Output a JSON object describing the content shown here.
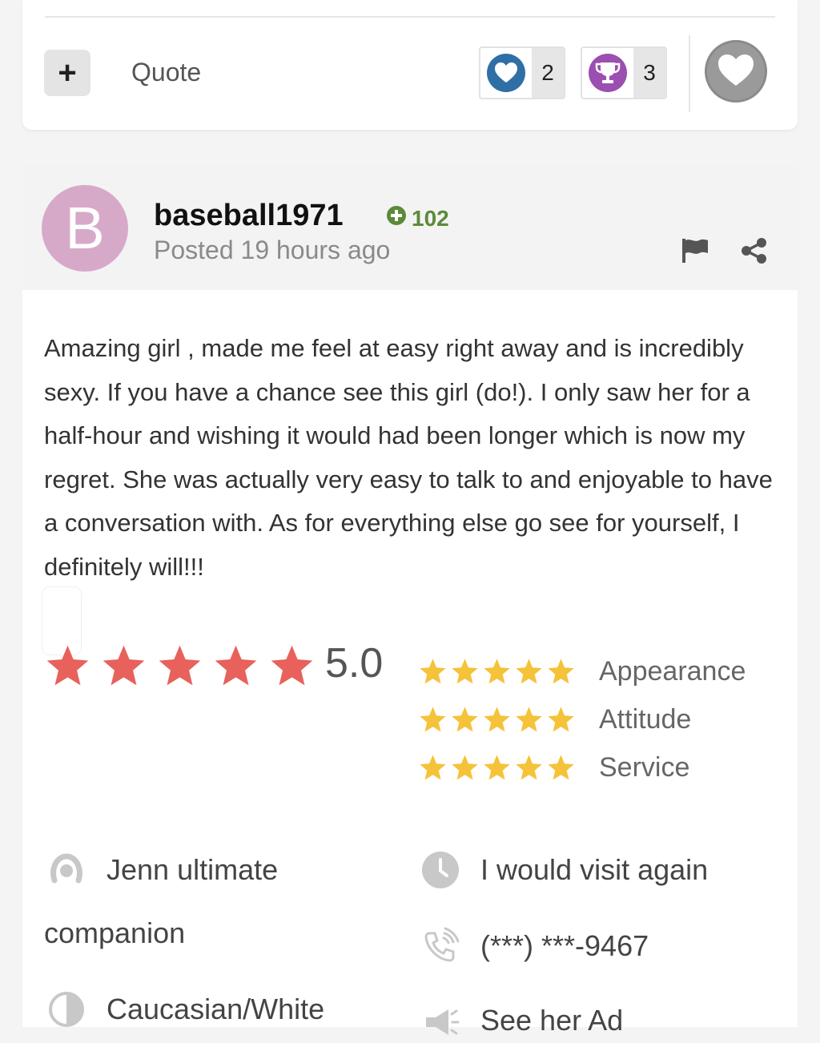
{
  "actions": {
    "add_symbol": "+",
    "quote_label": "Quote"
  },
  "reactions": {
    "like_count": "2",
    "trophy_count": "3"
  },
  "post": {
    "avatar_letter": "B",
    "username": "baseball1971",
    "points": "102",
    "posted": "Posted 19 hours ago",
    "body": "Amazing girl , made me feel at easy right away and is incredibly sexy. If you have a chance see this girl (do!). I only saw her for a half-hour and wishing it would had been longer which is now my regret. She was actually very easy to talk to and enjoyable to have a conversation with. As for everything else go see for yourself,  I definitely will!!!"
  },
  "rating": {
    "overall": "5.0",
    "overall_stars": 5,
    "categories": [
      {
        "label": "Appearance",
        "stars": 5
      },
      {
        "label": "Attitude",
        "stars": 5
      },
      {
        "label": "Service",
        "stars": 5
      }
    ]
  },
  "details": {
    "provider_line1": "Jenn ultimate",
    "provider_line2": "companion",
    "visit_again": "I would visit again",
    "phone": "(***) ***-9467",
    "ethnicity": "Caucasian/White",
    "ad_link": "See her Ad"
  },
  "colors": {
    "like_blue": "#2f6fa6",
    "trophy_purple": "#9b4fb0",
    "avatar_pink": "#d7a9c9",
    "points_green": "#5b8a3a",
    "big_star_red": "#e8615b",
    "small_star_gold": "#f5c23a"
  },
  "icons": [
    "plus-icon",
    "heart-icon",
    "trophy-icon",
    "favorite-heart-icon",
    "flag-icon",
    "share-icon",
    "plus-circle-icon",
    "star-icon",
    "profile-icon",
    "clock-icon",
    "phone-icon",
    "ethnicity-icon",
    "megaphone-icon"
  ]
}
